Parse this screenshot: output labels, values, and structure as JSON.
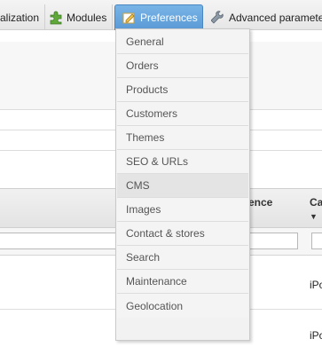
{
  "tabs": {
    "localization": "alization",
    "modules": "Modules",
    "preferences": "Preferences",
    "advanced": "Advanced paramete"
  },
  "dropdown": {
    "items": [
      "General",
      "Orders",
      "Products",
      "Customers",
      "Themes",
      "SEO & URLs",
      "CMS",
      "Images",
      "Contact & stores",
      "Search",
      "Maintenance",
      "Geolocation"
    ],
    "highlighted": "CMS"
  },
  "table": {
    "col_reference_partial": "ence",
    "col_category_partial": "Ca",
    "row1_text": "iPo",
    "row2_text": "iPo"
  },
  "colors": {
    "active_tab": "#5a99d6",
    "menu_bg": "#f4f4f4",
    "menu_hover": "#e4e4e4"
  }
}
